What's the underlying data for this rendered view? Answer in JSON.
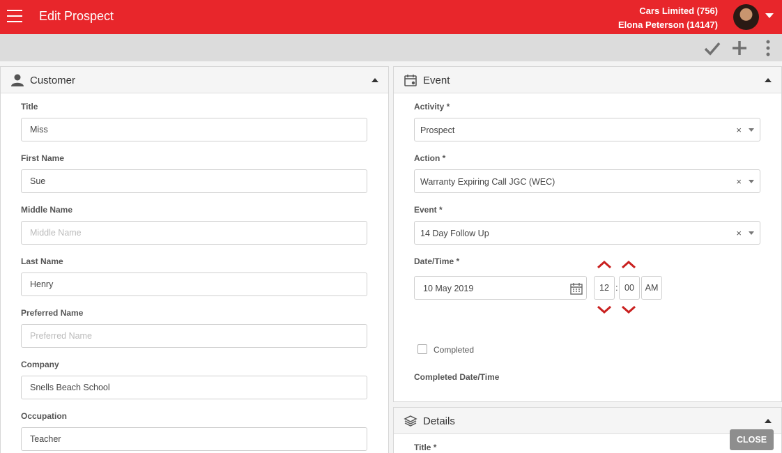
{
  "header": {
    "title": "Edit Prospect",
    "company": "Cars Limited (756)",
    "user": "Elona Peterson (14147)"
  },
  "toolbar": {
    "icons": [
      "checkmark-icon",
      "plus-icon",
      "more-vertical-icon"
    ]
  },
  "customer": {
    "title": "Customer",
    "fields": [
      {
        "label": "Title",
        "value": "Miss",
        "placeholder": ""
      },
      {
        "label": "First Name",
        "value": "Sue",
        "placeholder": ""
      },
      {
        "label": "Middle Name",
        "value": "",
        "placeholder": "Middle Name"
      },
      {
        "label": "Last Name",
        "value": "Henry",
        "placeholder": ""
      },
      {
        "label": "Preferred Name",
        "value": "",
        "placeholder": "Preferred Name"
      },
      {
        "label": "Company",
        "value": "Snells Beach School",
        "placeholder": ""
      },
      {
        "label": "Occupation",
        "value": "Teacher",
        "placeholder": ""
      }
    ]
  },
  "event": {
    "title": "Event",
    "activity": {
      "label": "Activity *",
      "value": "Prospect",
      "clear": "×"
    },
    "action": {
      "label": "Action *",
      "value": "Warranty Expiring Call JGC (WEC)",
      "clear": "×"
    },
    "event": {
      "label": "Event *",
      "value": "14 Day Follow Up",
      "clear": "×"
    },
    "datetime": {
      "label": "Date/Time *",
      "date": "10 May 2019",
      "hour": "12",
      "separator": ":",
      "minute": "00",
      "ampm": "AM"
    },
    "completed": {
      "label": "Completed",
      "checked": false
    },
    "completed_datetime_label": "Completed Date/Time"
  },
  "details": {
    "title": "Details",
    "first_label": "Title *"
  },
  "close_label": "CLOSE",
  "colors": {
    "brand": "#e8262b",
    "accent_chevron": "#c9201f",
    "close_button": "#8e8e8e"
  }
}
